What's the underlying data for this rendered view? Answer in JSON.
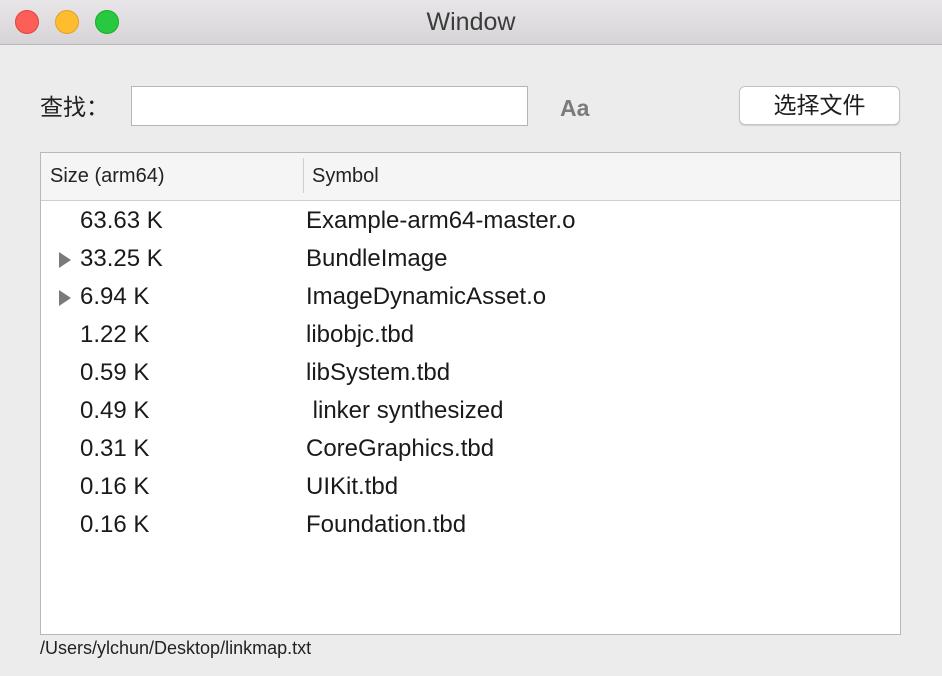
{
  "window": {
    "title": "Window"
  },
  "search": {
    "label": "查找：",
    "value": "",
    "placeholder": "",
    "case_toggle_label": "Aa"
  },
  "toolbar": {
    "choose_file_label": "选择文件"
  },
  "table": {
    "columns": [
      "Size (arm64)",
      "Symbol"
    ],
    "rows": [
      {
        "size": "63.63 K",
        "symbol": "Example-arm64-master.o",
        "expandable": false
      },
      {
        "size": "33.25 K",
        "symbol": "BundleImage",
        "expandable": true
      },
      {
        "size": "6.94 K",
        "symbol": "ImageDynamicAsset.o",
        "expandable": true
      },
      {
        "size": "1.22 K",
        "symbol": "libobjc.tbd",
        "expandable": false
      },
      {
        "size": "0.59 K",
        "symbol": "libSystem.tbd",
        "expandable": false
      },
      {
        "size": "0.49 K",
        "symbol": " linker synthesized",
        "expandable": false
      },
      {
        "size": "0.31 K",
        "symbol": "CoreGraphics.tbd",
        "expandable": false
      },
      {
        "size": "0.16 K",
        "symbol": "UIKit.tbd",
        "expandable": false
      },
      {
        "size": "0.16 K",
        "symbol": "Foundation.tbd",
        "expandable": false
      }
    ]
  },
  "status": {
    "path": "/Users/ylchun/Desktop/linkmap.txt"
  },
  "icons": {
    "close": "close-traffic-light-icon",
    "minimize": "minimize-traffic-light-icon",
    "maximize": "maximize-traffic-light-icon",
    "disclosure": "disclosure-triangle-icon"
  },
  "colors": {
    "close": "#fd5e57",
    "minimize": "#febc2e",
    "maximize": "#28c840"
  }
}
